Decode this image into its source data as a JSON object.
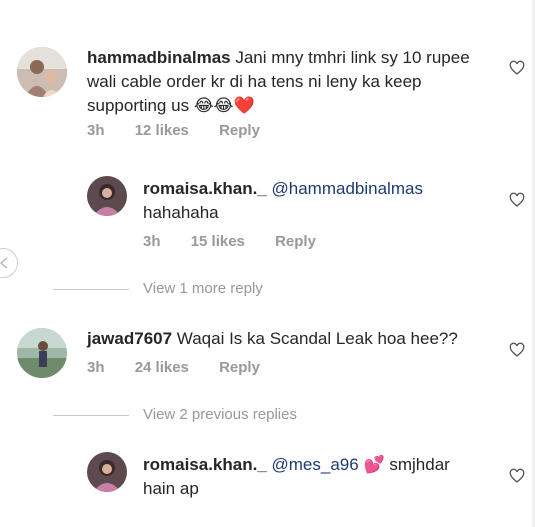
{
  "comments": [
    {
      "username": "hammadbinalmas",
      "text": "Jani mny tmhri link sy 10 rupee wali cable order kr di ha tens ni leny ka keep supporting us",
      "emoji": "😂😂❤️",
      "time": "3h",
      "likes": "12 likes",
      "reply": "Reply"
    },
    {
      "username": "romaisa.khan._",
      "mention": "@hammadbinalmas",
      "text": "hahahaha",
      "time": "3h",
      "likes": "15 likes",
      "reply": "Reply"
    },
    {
      "username": "jawad7607",
      "text": "Waqai Is ka Scandal Leak hoa hee??",
      "time": "3h",
      "likes": "24 likes",
      "reply": "Reply"
    },
    {
      "username": "romaisa.khan._",
      "mention": "@mes_a96",
      "emoji": "💕",
      "text": "smjhdar hain ap"
    }
  ],
  "view_more": "View 1 more reply",
  "view_previous": "View 2 previous replies",
  "colors": {
    "text": "#262626",
    "meta": "#999999",
    "mention": "#1e3a73"
  }
}
